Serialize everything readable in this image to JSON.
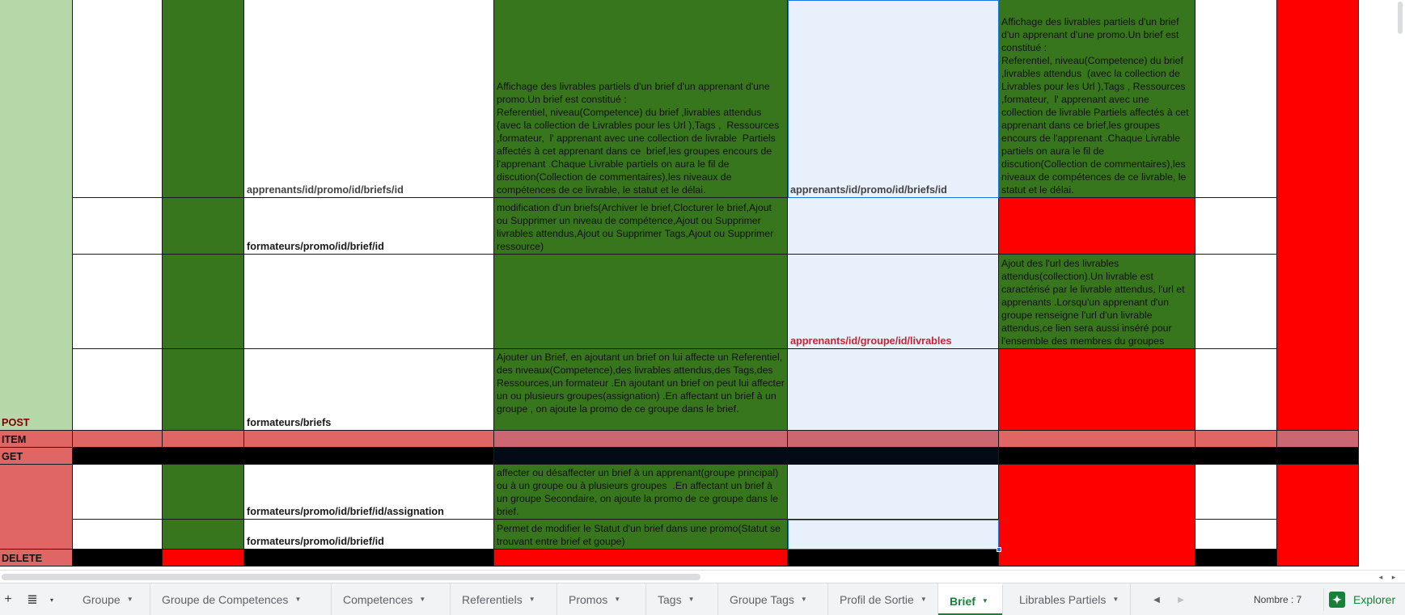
{
  "grid": {
    "rows": {
      "r1": {
        "route": "apprenants/id/promo/id/briefs/id",
        "description": "Affichage des livrables partiels d'un brief d'un apprenant d'une promo.Un brief est constitué :\nReferentiel, niveau(Competence) du brief ,livrables attendus (avec la collection de Livrables pour les Url ),Tags ,  Ressources  ,formateur,  l' apprenant avec une collection de livrable  Partiels affectés à cet apprenant dans ce  brief,les groupes encours de l'apprenant .Chaque Livrable partiels on aura le fil de discution(Collection de commentaires),les niveaux de compétences de ce livrable, le statut et le délai.",
        "route_alt": "apprenants/id/promo/id/briefs/id",
        "description_alt": "Affichage des livrables partiels d'un brief d'un apprenant d'une promo.Un brief est constitué :\nReferentiel, niveau(Competence) du brief ,livrables attendus  (avec la collection de Livrables pour les Url ),Tags , Ressources  ,formateur,  l' apprenant avec une collection de livrable Partiels affectés à cet apprenant dans ce brief,les groupes encours de l'apprenant .Chaque Livrable partiels on aura le fil de discution(Collection de commentaires),les niveaux de compétences de ce livrable, le statut et le délai."
      },
      "r2": {
        "route": "formateurs/promo/id/brief/id",
        "description": "modification d'un briefs(Archiver le brief,Clocturer le brief,Ajout ou Supprimer un niveau de compétence,Ajout ou Supprimer livrables attendus,Ajout ou Supprimer Tags,Ajout ou Supprimer ressource)"
      },
      "r3": {
        "route_alt": "apprenants/id/groupe/id/livrables",
        "description_alt": "Ajout des l'url des livrables attendus(collection).Un livrable est caractérisé par le livrable attendus, l'url et apprenants .Lorsqu'un apprenant d'un groupe renseigne l'url d'un livrable attendus,ce lien sera aussi inséré pour l'ensemble des membres du groupes"
      },
      "r4": {
        "method": "POST",
        "route": "formateurs/briefs",
        "description": "Ajouter un Brief, en ajoutant un brief on lui affecte un Referentiel, des niveaux(Competence),des livrables attendus,des Tags,des Ressources,un formateur .En ajoutant un brief on peut lui affecter un ou plusieurs groupes(assignation) .En affectant un brief à un groupe , on ajoute la promo de ce groupe dans le brief."
      },
      "item": {
        "label": "ITEM"
      },
      "get": {
        "label": "GET"
      },
      "r7": {
        "route": "formateurs/promo/id/brief/id/assignation",
        "description": "affecter ou désaffecter un brief à un apprenant(groupe principal) ou à un groupe ou à plusieurs groupes  .En affectant un brief à un groupe Secondaire, on ajoute la promo de ce groupe dans le brief."
      },
      "r8": {
        "route": "formateurs/promo/id/brief/id",
        "description": "Permet de modifier le Statut d'un brief dans une promo(Statut se trouvant entre brief et goupe)"
      },
      "delete": {
        "label": "DELETE"
      }
    }
  },
  "sheet_tabs": [
    {
      "label": "Groupe",
      "active": false
    },
    {
      "label": "Groupe de Competences",
      "active": false
    },
    {
      "label": "Competences",
      "active": false
    },
    {
      "label": "Referentiels",
      "active": false
    },
    {
      "label": "Promos",
      "active": false
    },
    {
      "label": "Tags",
      "active": false
    },
    {
      "label": "Groupe Tags",
      "active": false
    },
    {
      "label": "Profil de Sortie",
      "active": false
    },
    {
      "label": "Brief",
      "active": true
    },
    {
      "label": "Librables Partiels",
      "active": false
    }
  ],
  "tabbar": {
    "add_sheet_icon": "plus-icon",
    "all_sheets_icon": "list-icon",
    "count_text": "Nombre : 7",
    "explore_label": "Explorer",
    "explore_icon": "explore-icon"
  },
  "colors": {
    "light_green": "#b6d7a8",
    "dark_green": "#38761d",
    "light_blue": "#e8f0fc",
    "red": "#ff0000",
    "pink": "#e06666",
    "black": "#000000",
    "active_tab": "#188038"
  }
}
